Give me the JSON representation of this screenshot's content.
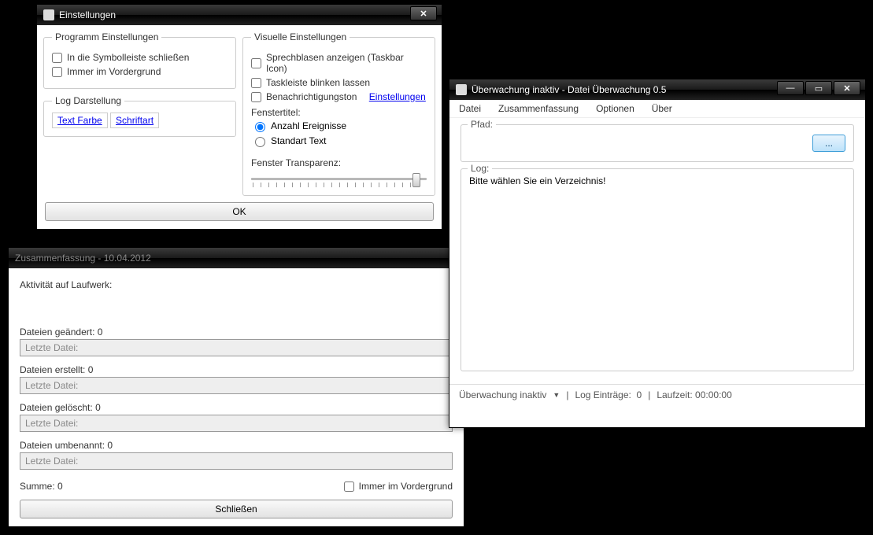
{
  "settings": {
    "title": "Einstellungen",
    "program": {
      "legend": "Programm Einstellungen",
      "close_to_tray": "In die Symbolleiste schließen",
      "always_on_top": "Immer im Vordergrund"
    },
    "log_display": {
      "legend": "Log Darstellung",
      "text_color": "Text Farbe",
      "font": "Schriftart"
    },
    "visual": {
      "legend": "Visuelle Einstellungen",
      "show_balloons": "Sprechblasen anzeigen (Taskbar Icon)",
      "blink_taskbar": "Taskleiste blinken lassen",
      "sound": "Benachrichtigungston",
      "sound_settings": "Einstellungen",
      "window_title_label": "Fenstertitel:",
      "radio_count": "Anzahl Ereignisse",
      "radio_std": "Standart Text",
      "transparency_label": "Fenster Transparenz:"
    },
    "ok": "OK"
  },
  "summary": {
    "title": "Zusammenfassung - 10.04.2012",
    "activity_label": "Aktivität auf Laufwerk:",
    "changed_label": "Dateien geändert:",
    "changed_count": "0",
    "created_label": "Dateien erstellt:",
    "created_count": "0",
    "deleted_label": "Dateien gelöscht:",
    "deleted_count": "0",
    "renamed_label": "Dateien umbenannt:",
    "renamed_count": "0",
    "last_file": "Letzte Datei:",
    "sum_label": "Summe:",
    "sum_value": "0",
    "always_top": "Immer im Vordergrund",
    "close": "Schließen"
  },
  "main": {
    "title": "Überwachung inaktiv - Datei Überwachung 0.5",
    "menu": {
      "file": "Datei",
      "summary": "Zusammenfassung",
      "options": "Optionen",
      "about": "Über"
    },
    "path_label": "Pfad:",
    "browse": "...",
    "log_label": "Log:",
    "log_text": "Bitte wählen Sie ein Verzeichnis!",
    "status_watch": "Überwachung inaktiv",
    "status_entries_label": "Log Einträge:",
    "status_entries_value": "0",
    "status_runtime_label": "Laufzeit:",
    "status_runtime_value": "00:00:00"
  }
}
